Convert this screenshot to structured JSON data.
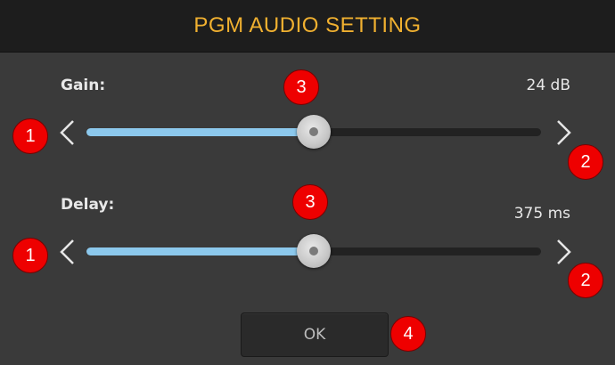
{
  "title": "PGM AUDIO SETTING",
  "gain": {
    "label": "Gain:",
    "value": "24 dB",
    "level": 0.5
  },
  "delay": {
    "label": "Delay:",
    "value": "375 ms",
    "level": 0.5
  },
  "ok_label": "OK",
  "annotations": [
    "1",
    "2",
    "3",
    "4"
  ],
  "colors": {
    "title": "#f0b030",
    "slider_fill": "#8cc8ec",
    "badge": "#ee0000",
    "background": "#3a3a3a",
    "titlebar": "#1d1d1d"
  },
  "icons": {
    "decrease": "chevron-left-icon",
    "increase": "chevron-right-icon"
  }
}
